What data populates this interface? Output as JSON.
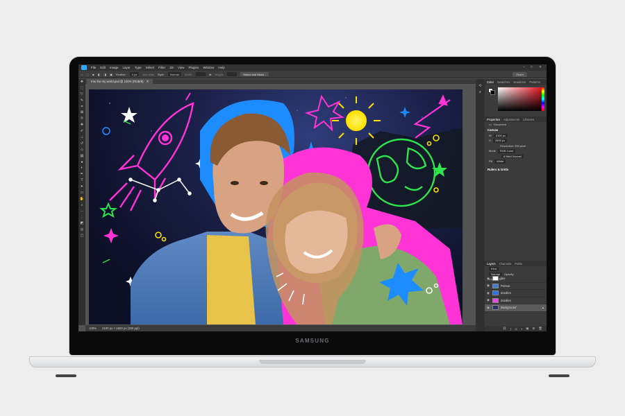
{
  "laptop": {
    "brand": "SAMSUNG"
  },
  "menubar": {
    "items": [
      "File",
      "Edit",
      "Image",
      "Layer",
      "Type",
      "Select",
      "Filter",
      "3D",
      "View",
      "Plugins",
      "Window",
      "Help"
    ]
  },
  "options": {
    "feather_label": "Feather:",
    "feather_value": "0 px",
    "antialias_label": "Anti-alias",
    "style_label": "Style:",
    "style_value": "Normal",
    "width_label": "Width:",
    "height_label": "Height:",
    "select_mask_label": "Select and Mask...",
    "share_label": "Share"
  },
  "document": {
    "tab_title": "Into the my world.psd @ 100% (RGB/8)",
    "status_zoom": "100%",
    "status_info": "2100 px × 1500 px (300 ppi)"
  },
  "color_panel": {
    "tabs": [
      "Color",
      "Swatches",
      "Gradients",
      "Patterns"
    ]
  },
  "properties_panel": {
    "tabs": [
      "Properties",
      "Adjustments",
      "Libraries"
    ],
    "type_label": "Document",
    "canvas_heading": "Canvas",
    "w_label": "W",
    "w_value": "2100 px",
    "h_label": "H",
    "h_value": "1500 px",
    "resolution": "Resolution: 300 pixel",
    "mode_label": "Mode",
    "mode_value": "RGB Color",
    "depth_value": "8 Bits/Channel",
    "fill_label": "Fill",
    "fill_value": "White",
    "rulers_heading": "Rulers & Grids"
  },
  "layers_panel": {
    "tabs": [
      "Layers",
      "Channels",
      "Paths"
    ],
    "kind_label": "Kind",
    "blend_value": "Normal",
    "opacity_label": "Opacity:",
    "lock_label": "Lock:",
    "fill_label": "Fill:",
    "layers": [
      {
        "name": "line",
        "thumb": "#ffffff"
      },
      {
        "name": "Person",
        "thumb": "#4b7bc7"
      },
      {
        "name": "doodles",
        "thumb": "#2f6fe0"
      },
      {
        "name": "doodles",
        "thumb": "#e14fd8"
      },
      {
        "name": "Background",
        "thumb": "#2b2f5e"
      }
    ]
  },
  "colors": {
    "ps_dark": "#323232",
    "panel_bg": "#3b3b3b",
    "neon_pink": "#ff33d6",
    "neon_blue": "#1d8cff",
    "neon_green": "#2ee54d",
    "neon_yellow": "#ffe100"
  }
}
